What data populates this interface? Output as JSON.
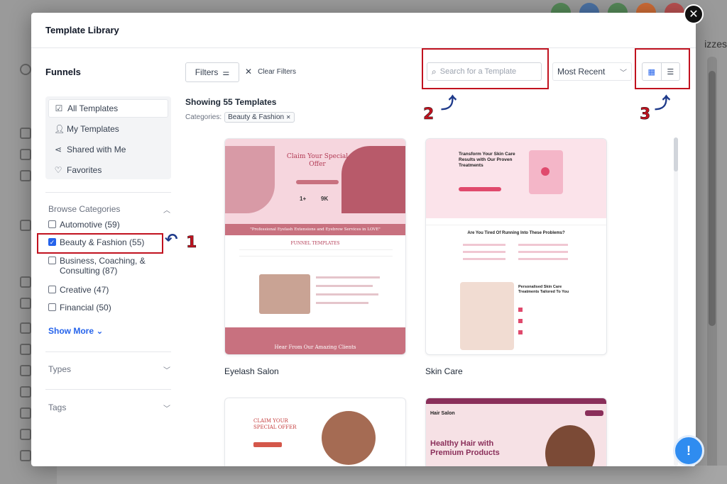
{
  "modal": {
    "title": "Template Library"
  },
  "left": {
    "funnels_title": "Funnels",
    "nav": [
      {
        "label": "All Templates",
        "icon": "checkbox-icon"
      },
      {
        "label": "My Templates",
        "icon": "user-icon"
      },
      {
        "label": "Shared with Me",
        "icon": "share-icon"
      },
      {
        "label": "Favorites",
        "icon": "heart-icon"
      }
    ],
    "browse_title": "Browse Categories",
    "categories": [
      {
        "label": "Automotive (59)",
        "checked": false
      },
      {
        "label": "Beauty & Fashion (55)",
        "checked": true
      },
      {
        "label": "Business, Coaching, & Consulting (87)",
        "checked": false
      },
      {
        "label": "Creative (47)",
        "checked": false
      },
      {
        "label": "Financial (50)",
        "checked": false
      }
    ],
    "show_more": "Show More",
    "types_title": "Types",
    "tags_title": "Tags"
  },
  "toolbar": {
    "filters_label": "Filters",
    "clear_filters": "Clear Filters",
    "search_placeholder": "Search for a Template",
    "sort_value": "Most Recent"
  },
  "results": {
    "showing": "Showing 55 Templates",
    "categories_label": "Categories:",
    "chip": "Beauty & Fashion"
  },
  "cards": [
    {
      "name": "Eyelash Salon",
      "heading": "Claim Your Special Offer",
      "banner": "\"Professional Eyelash Extensions and Eyebrow Services in LOVE\"",
      "section": "FUNNEL TEMPLATES",
      "stat1": "1+",
      "stat2": "9K",
      "footer": "Hear From Our Amazing Clients"
    },
    {
      "name": "Skin Care",
      "heading": "Transform Your Skin Care Results with Our Proven Treatments",
      "question": "Are You Tired Of Running Into These Problems?",
      "solution": "Personalised Skin Care Treatments Tailored To You"
    },
    {
      "heading": "CLAIM YOUR SPECIAL OFFER"
    },
    {
      "brand": "Hair Salon",
      "heading": "Healthy Hair with Premium Products"
    }
  ],
  "annotations": {
    "step1": "1",
    "step2": "2",
    "step3": "3"
  },
  "background": {
    "right_text": "izzes"
  },
  "colors": {
    "accent": "#2563eb",
    "annotation_red": "#c1121f",
    "pink": "#c8717f",
    "light_pink": "#f6d6de"
  }
}
